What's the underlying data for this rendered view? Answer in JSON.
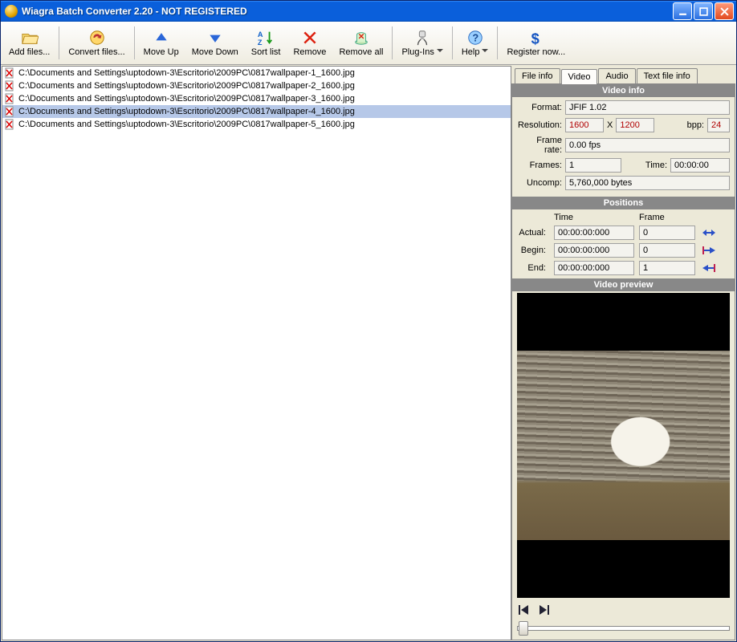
{
  "title": "Wiagra Batch Converter 2.20 - NOT REGISTERED",
  "toolbar": {
    "add_files": "Add files...",
    "convert_files": "Convert files...",
    "move_up": "Move Up",
    "move_down": "Move Down",
    "sort_list": "Sort list",
    "remove": "Remove",
    "remove_all": "Remove all",
    "plugins": "Plug-Ins",
    "help": "Help",
    "register": "Register now..."
  },
  "files": [
    {
      "path": "C:\\Documents and Settings\\uptodown-3\\Escritorio\\2009PC\\0817wallpaper-1_1600.jpg",
      "selected": false
    },
    {
      "path": "C:\\Documents and Settings\\uptodown-3\\Escritorio\\2009PC\\0817wallpaper-2_1600.jpg",
      "selected": false
    },
    {
      "path": "C:\\Documents and Settings\\uptodown-3\\Escritorio\\2009PC\\0817wallpaper-3_1600.jpg",
      "selected": false
    },
    {
      "path": "C:\\Documents and Settings\\uptodown-3\\Escritorio\\2009PC\\0817wallpaper-4_1600.jpg",
      "selected": true
    },
    {
      "path": "C:\\Documents and Settings\\uptodown-3\\Escritorio\\2009PC\\0817wallpaper-5_1600.jpg",
      "selected": false
    }
  ],
  "tabs": {
    "file_info": "File info",
    "video": "Video",
    "audio": "Audio",
    "text_file_info": "Text file info",
    "active": "video"
  },
  "video_info": {
    "header": "Video info",
    "format_label": "Format:",
    "format": "JFIF 1.02",
    "resolution_label": "Resolution:",
    "res_w": "1600",
    "res_x": "X",
    "res_h": "1200",
    "bpp_label": "bpp:",
    "bpp": "24",
    "frame_rate_label": "Frame rate:",
    "frame_rate": "0.00 fps",
    "frames_label": "Frames:",
    "frames": "1",
    "time_label": "Time:",
    "time": "00:00:00",
    "uncomp_label": "Uncomp:",
    "uncomp": "5,760,000 bytes"
  },
  "positions": {
    "header": "Positions",
    "col_time": "Time",
    "col_frame": "Frame",
    "actual_label": "Actual:",
    "actual_time": "00:00:00:000",
    "actual_frame": "0",
    "begin_label": "Begin:",
    "begin_time": "00:00:00:000",
    "begin_frame": "0",
    "end_label": "End:",
    "end_time": "00:00:00:000",
    "end_frame": "1"
  },
  "preview": {
    "header": "Video preview"
  }
}
